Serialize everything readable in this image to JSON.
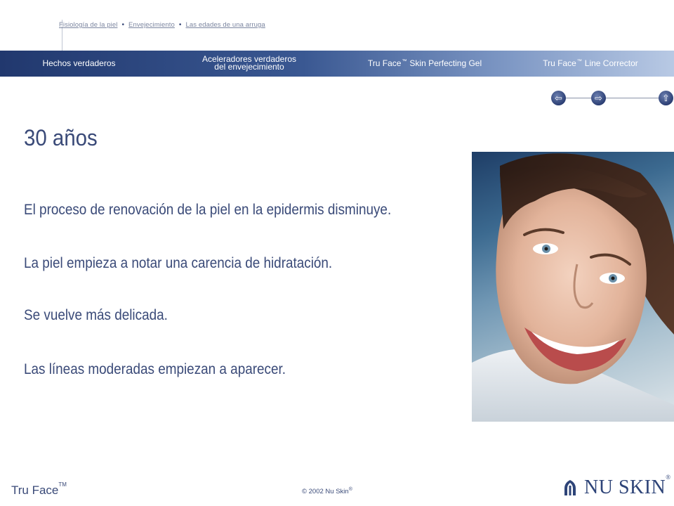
{
  "breadcrumb": {
    "items": [
      "Fisiología de la piel",
      "Envejecimiento",
      "Las edades de una arruga"
    ]
  },
  "nav": {
    "hechos": "Hechos verdaderos",
    "aceleradores_line1": "Aceleradores verdaderos",
    "aceleradores_line2": "del envejecimiento",
    "gel_prefix": "Tru Face",
    "gel_tm": "™",
    "gel_suffix": "Skin Perfecting Gel",
    "line_prefix": "Tru Face",
    "line_tm": "™",
    "line_suffix": "Line Corrector"
  },
  "arrows": {
    "back_icon": "⇦",
    "forward_icon": "⇨",
    "up_icon": "⇧"
  },
  "main": {
    "title": "30 años",
    "bullets": [
      "El proceso de renovación de la piel en la epidermis disminuye.",
      "La piel empieza a notar una carencia de hidratación.",
      "Se vuelve más delicada.",
      "Las líneas moderadas empiezan a aparecer."
    ]
  },
  "footer": {
    "brand": "Tru Face",
    "brand_tm": "TM",
    "copyright": "© 2002 Nu Skin",
    "copyright_reg": "®",
    "logo_text": "NU SKIN",
    "logo_reg": "®"
  },
  "colors": {
    "text_primary": "#3a4a78",
    "nav_dark": "#21386e",
    "nav_light": "#b8c9e4"
  }
}
